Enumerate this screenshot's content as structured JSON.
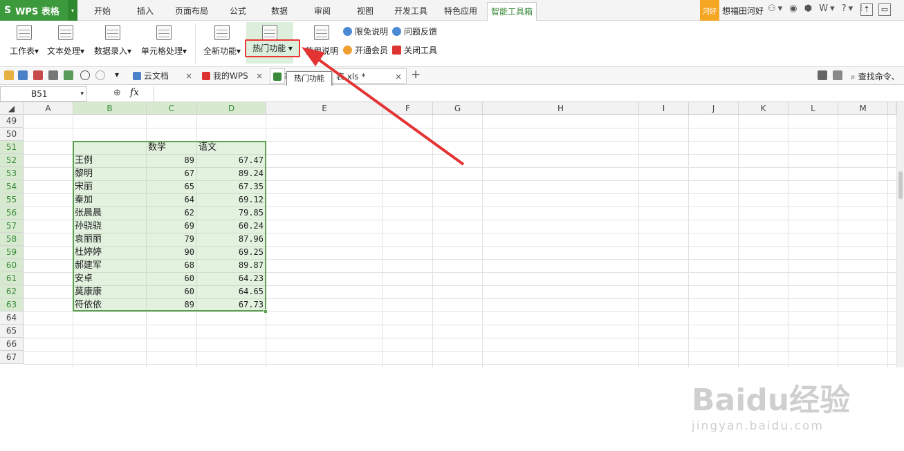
{
  "app": {
    "logo_label": "WPS 表格"
  },
  "menu_tabs": [
    "开始",
    "插入",
    "页面布局",
    "公式",
    "数据",
    "审阅",
    "视图",
    "开发工具",
    "特色应用",
    "智能工具箱"
  ],
  "account": {
    "badge": "河好",
    "username": "想福田河好"
  },
  "ribbon": {
    "buttons": [
      "工作表",
      "文本处理",
      "数据录入",
      "单元格处理",
      "全新功能",
      "热门功能",
      "使用说明"
    ],
    "small": [
      "限免说明",
      "问题反馈",
      "开通会员",
      "关闭工具"
    ]
  },
  "doc_tabs": [
    "云文档",
    "我的WPS",
    "表",
    "表.xls *"
  ],
  "search_label": "查找命令、",
  "tooltip": "热门功能",
  "formula": {
    "cell_ref": "B51",
    "fx": "fx"
  },
  "columns": [
    "A",
    "B",
    "C",
    "D",
    "E",
    "F",
    "G",
    "H",
    "I",
    "J",
    "K",
    "L",
    "M"
  ],
  "rows": [
    "49",
    "50",
    "51",
    "52",
    "53",
    "54",
    "55",
    "56",
    "57",
    "58",
    "59",
    "60",
    "61",
    "62",
    "63",
    "64",
    "65",
    "66",
    "67"
  ],
  "table": {
    "headers": [
      "数学",
      "语文"
    ],
    "records": [
      {
        "name": "王例",
        "math": "89",
        "chinese": "67.47"
      },
      {
        "name": "黎明",
        "math": "67",
        "chinese": "89.24"
      },
      {
        "name": "宋丽",
        "math": "65",
        "chinese": "67.35"
      },
      {
        "name": "秦加",
        "math": "64",
        "chinese": "69.12"
      },
      {
        "name": "张晨晨",
        "math": "62",
        "chinese": "79.85"
      },
      {
        "name": "孙骁骁",
        "math": "69",
        "chinese": "60.24"
      },
      {
        "name": "袁丽丽",
        "math": "79",
        "chinese": "87.96"
      },
      {
        "name": "杜婷婷",
        "math": "90",
        "chinese": "69.25"
      },
      {
        "name": "郝建军",
        "math": "68",
        "chinese": "89.87"
      },
      {
        "name": "安卓",
        "math": "60",
        "chinese": "64.23"
      },
      {
        "name": "莫康康",
        "math": "60",
        "chinese": "64.65"
      },
      {
        "name": "符依依",
        "math": "89",
        "chinese": "67.73"
      }
    ]
  },
  "watermark": {
    "line1": "Baidu经验",
    "line2": "jingyan.baidu.com"
  },
  "colors": {
    "accent": "#3a8a3a",
    "highlight": "#e33333"
  }
}
